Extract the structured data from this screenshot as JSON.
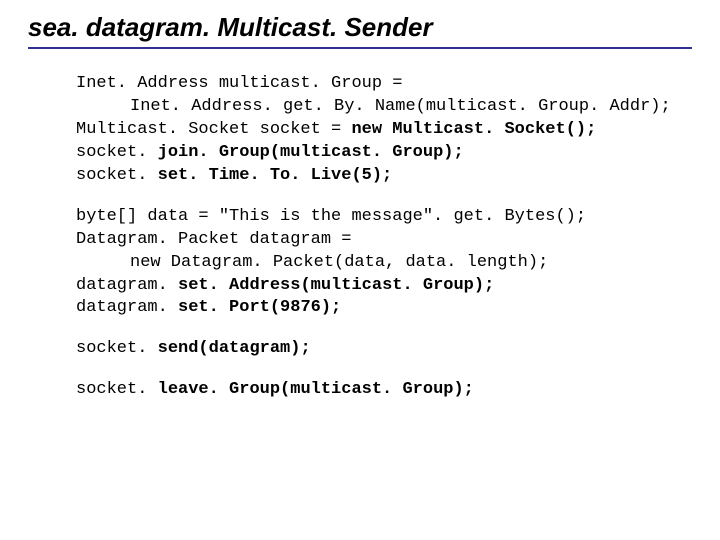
{
  "title": "sea. datagram. Multicast. Sender",
  "code": {
    "l1": "Inet. Address multicast. Group =",
    "l2": "Inet. Address. get. By. Name(multicast. Group. Addr);",
    "l3a": "Multicast. Socket socket = ",
    "l3b_bold": "new Multicast. Socket();",
    "l4a": "socket. ",
    "l4b_bold": "join. Group(multicast. Group);",
    "l5a": "socket. ",
    "l5b_bold": "set. Time. To. Live(5);",
    "l6": "byte[] data = \"This is the message\". get. Bytes();",
    "l7": "Datagram. Packet datagram =",
    "l8": "new Datagram. Packet(data, data. length);",
    "l9a": "datagram. ",
    "l9b_bold": "set. Address(multicast. Group);",
    "l10a": "datagram. ",
    "l10b_bold": "set. Port(9876);",
    "l11a": "socket. ",
    "l11b_bold": "send(datagram);",
    "l12a": "socket. ",
    "l12b_bold": "leave. Group(multicast. Group);"
  }
}
